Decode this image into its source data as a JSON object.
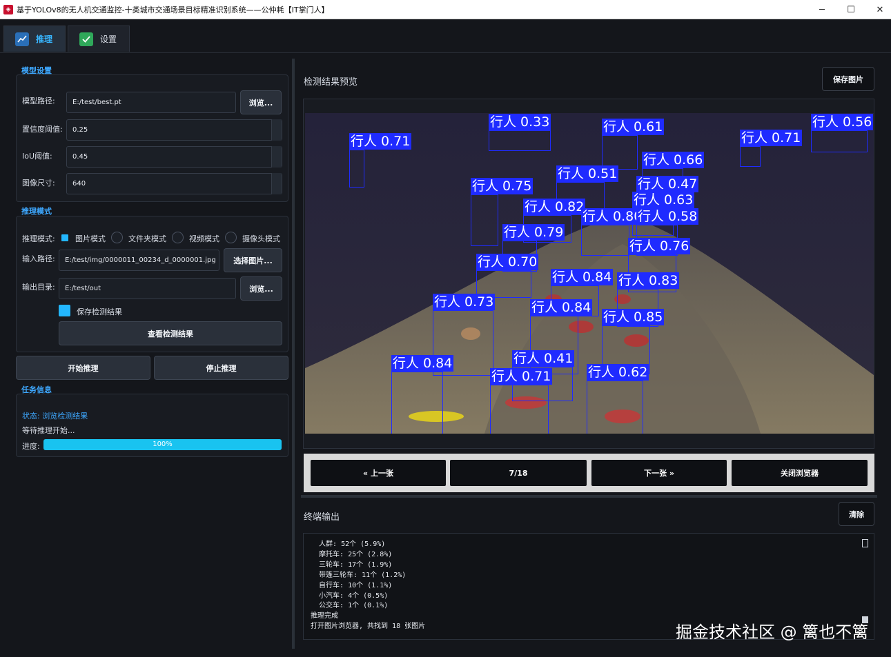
{
  "window": {
    "title": "基于YOLOv8的无人机交通监控-十类城市交通场景目标精准识别系统——公仲耗【IT掌门人】",
    "minimize": "─",
    "maximize": "☐",
    "close": "✕"
  },
  "tabs": [
    {
      "label": "推理",
      "icon": "chart-line-icon",
      "active": true
    },
    {
      "label": "设置",
      "icon": "check-settings-icon",
      "active": false
    }
  ],
  "model_settings": {
    "title": "模型设置",
    "model_path_label": "模型路径:",
    "model_path_value": "E:/test/best.pt",
    "browse_label": "浏览...",
    "confidence_label": "置信度阈值:",
    "confidence_value": "0.25",
    "iou_label": "IoU阈值:",
    "iou_value": "0.45",
    "imgsz_label": "图像尺寸:",
    "imgsz_value": "640"
  },
  "inference_mode": {
    "title": "推理模式",
    "mode_label": "推理模式:",
    "options": [
      "图片模式",
      "文件夹模式",
      "视频模式",
      "摄像头模式"
    ],
    "selected": "图片模式",
    "input_label": "输入路径:",
    "input_value": "E:/test/img/0000011_00234_d_0000001.jpg",
    "select_image_label": "选择图片...",
    "output_label": "输出目录:",
    "output_value": "E:/test/out",
    "output_browse_label": "浏览...",
    "save_results_label": "保存检测结果",
    "save_results_checked": true,
    "view_results_label": "查看检测结果"
  },
  "actions": {
    "start_label": "开始推理",
    "stop_label": "停止推理"
  },
  "task_info": {
    "title": "任务信息",
    "status_text": "状态: 浏览检测结果",
    "message": "等待推理开始...",
    "progress_label": "进度:",
    "progress_percent": 100,
    "progress_text": "100%"
  },
  "preview": {
    "title": "检测结果预览",
    "save_image_label": "保存图片",
    "detections": [
      {
        "label": "行人 0.71"
      },
      {
        "label": "行人 0.33"
      },
      {
        "label": "行人 0.61"
      },
      {
        "label": "行人 0.71"
      },
      {
        "label": "行人 0.56"
      },
      {
        "label": "行人 0.66"
      },
      {
        "label": "行人 0.51"
      },
      {
        "label": "行人 0.47"
      },
      {
        "label": "行人 0.75"
      },
      {
        "label": "行人 0.63"
      },
      {
        "label": "行人 0.82"
      },
      {
        "label": "行人 0.80"
      },
      {
        "label": "行人 0.58"
      },
      {
        "label": "行人 0.79"
      },
      {
        "label": "行人 0.76"
      },
      {
        "label": "行人 0.70"
      },
      {
        "label": "行人 0.84"
      },
      {
        "label": "行人 0.83"
      },
      {
        "label": "行人 0.73"
      },
      {
        "label": "行人 0.84"
      },
      {
        "label": "行人 0.85"
      },
      {
        "label": "行人 0.84"
      },
      {
        "label": "行人 0.41"
      },
      {
        "label": "行人 0.71"
      },
      {
        "label": "行人 0.62"
      }
    ]
  },
  "navigation": {
    "prev_label": "« 上一张",
    "counter": "7/18",
    "next_label": "下一张 »",
    "close_label": "关闭浏览器"
  },
  "terminal": {
    "title": "终端输出",
    "clear_label": "清除",
    "lines": [
      "  人群: 52个 (5.9%)",
      "  摩托车: 25个 (2.8%)",
      "  三轮车: 17个 (1.9%)",
      "  带篷三轮车: 11个 (1.2%)",
      "  自行车: 10个 (1.1%)",
      "  小汽车: 4个 (0.5%)",
      "  公交车: 1个 (0.1%)",
      "推理完成",
      "打开图片浏览器, 共找到 18 张图片"
    ]
  },
  "watermark": "掘金技术社区 @ 篱也不篱",
  "colors": {
    "accent": "#38b6ff",
    "progress": "#19c3f0",
    "detection_box": "#1f2bff",
    "background": "#14161b"
  }
}
